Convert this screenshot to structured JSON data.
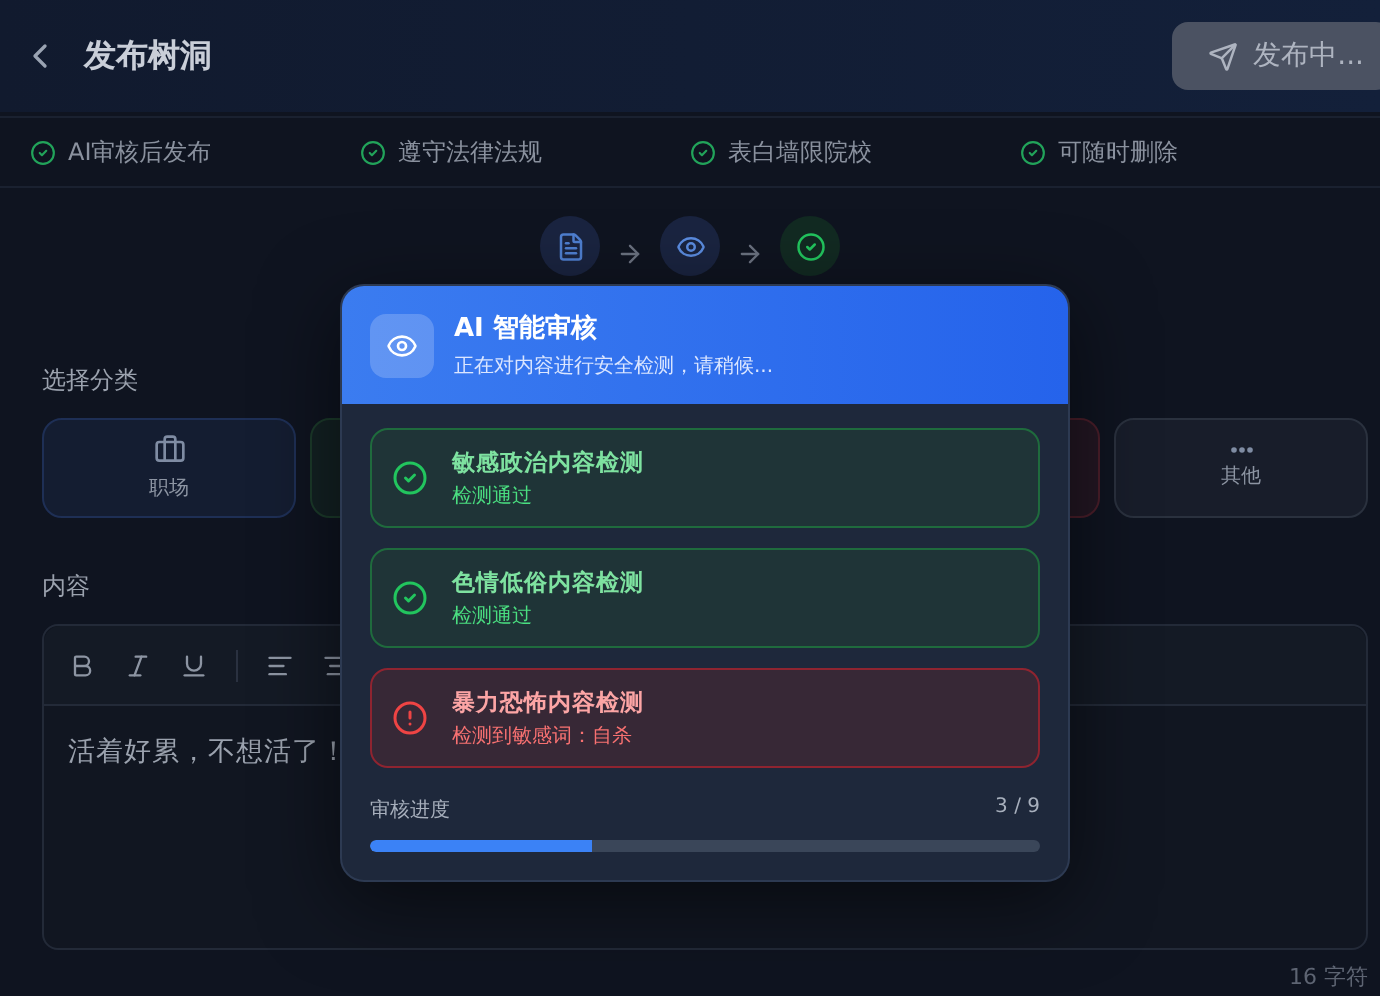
{
  "header": {
    "title": "发布树洞",
    "publish_button": {
      "label": "发布中...",
      "disabled": true
    }
  },
  "rules": [
    "AI审核后发布",
    "遵守法律法规",
    "表白墙限院校",
    "可随时删除"
  ],
  "steps": [
    {
      "kind": "document"
    },
    {
      "kind": "review"
    },
    {
      "kind": "done"
    }
  ],
  "category_section": {
    "label": "选择分类",
    "categories": [
      {
        "kind": "work",
        "label": "职场",
        "color": "#1e2f55"
      },
      {
        "kind": "blank",
        "color": "#1c3b2b"
      },
      {
        "kind": "blank",
        "color": "#4a1e2a"
      },
      {
        "kind": "more",
        "label": "其他",
        "color": "#2a313e"
      }
    ]
  },
  "content_section": {
    "label": "内容",
    "value": "活着好累，不想活了！",
    "char_count": "16 字符"
  },
  "review_dialog": {
    "title": "AI 智能审核",
    "subtitle": "正在对内容进行安全检测，请稍候...",
    "checks": [
      {
        "title": "敏感政治内容检测",
        "detail": "检测通过",
        "passed": true
      },
      {
        "title": "色情低俗内容检测",
        "detail": "检测通过",
        "passed": true
      },
      {
        "title": "暴力恐怖内容检测",
        "detail": "检测到敏感词：自杀",
        "passed": false
      }
    ],
    "progress": {
      "label": "审核进度",
      "reading": "3 / 9",
      "level": 0.33
    }
  }
}
